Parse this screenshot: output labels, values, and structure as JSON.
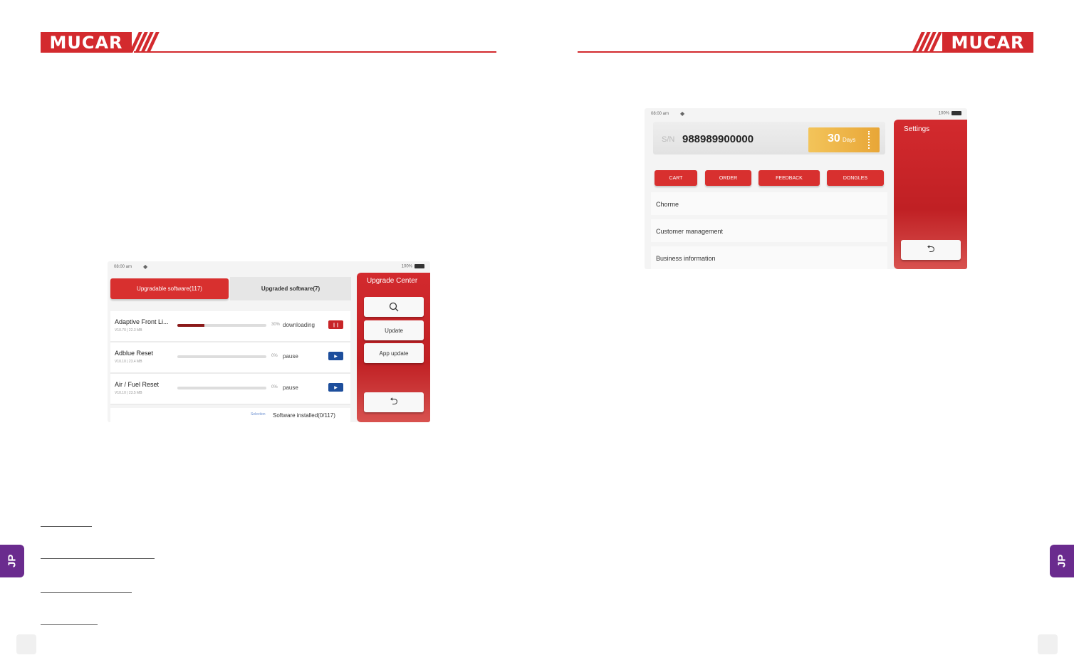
{
  "brand": {
    "logo_text": "MUCAR",
    "accent": "#d32a2e"
  },
  "side_tab": {
    "label": "JP",
    "color": "#6a2b8e"
  },
  "upgrade_screen": {
    "status": {
      "time": "08:00 am",
      "battery": "100%"
    },
    "tabs": {
      "upgradable": "Upgradable software(117)",
      "upgraded": "Upgraded software(7)"
    },
    "items": [
      {
        "name": "Adaptive Front Li...",
        "version": "V10.70 | 22.3 MB",
        "progress": 0.3,
        "percent": "30%",
        "status": "downloading",
        "action": "❙❙"
      },
      {
        "name": "Adblue Reset",
        "version": "V10.10 | 23.4 MB",
        "progress": 0,
        "percent": "0%",
        "status": "pause",
        "action": "▶"
      },
      {
        "name": "Air / Fuel Reset",
        "version": "V10.10 | 23.5 MB",
        "progress": 0,
        "percent": "0%",
        "status": "pause",
        "action": "▶"
      }
    ],
    "footer": {
      "label": "Selection",
      "installed": "Software installed(0/117)"
    },
    "sidebar": {
      "title": "Upgrade Center",
      "update": "Update",
      "app_update": "App update",
      "back": "⮌"
    }
  },
  "settings_screen": {
    "status": {
      "time": "08:00 am",
      "battery": "100%"
    },
    "sn_label": "S/N",
    "sn_value": "988989900000",
    "days": {
      "number": "30",
      "unit": "Days"
    },
    "buttons": [
      "CART",
      "ORDER",
      "FEEDBACK",
      "DONGLES"
    ],
    "menu": [
      "Chorme",
      "Customer management",
      "Business information"
    ],
    "sidebar": {
      "title": "Settings",
      "back": "⮌"
    }
  }
}
